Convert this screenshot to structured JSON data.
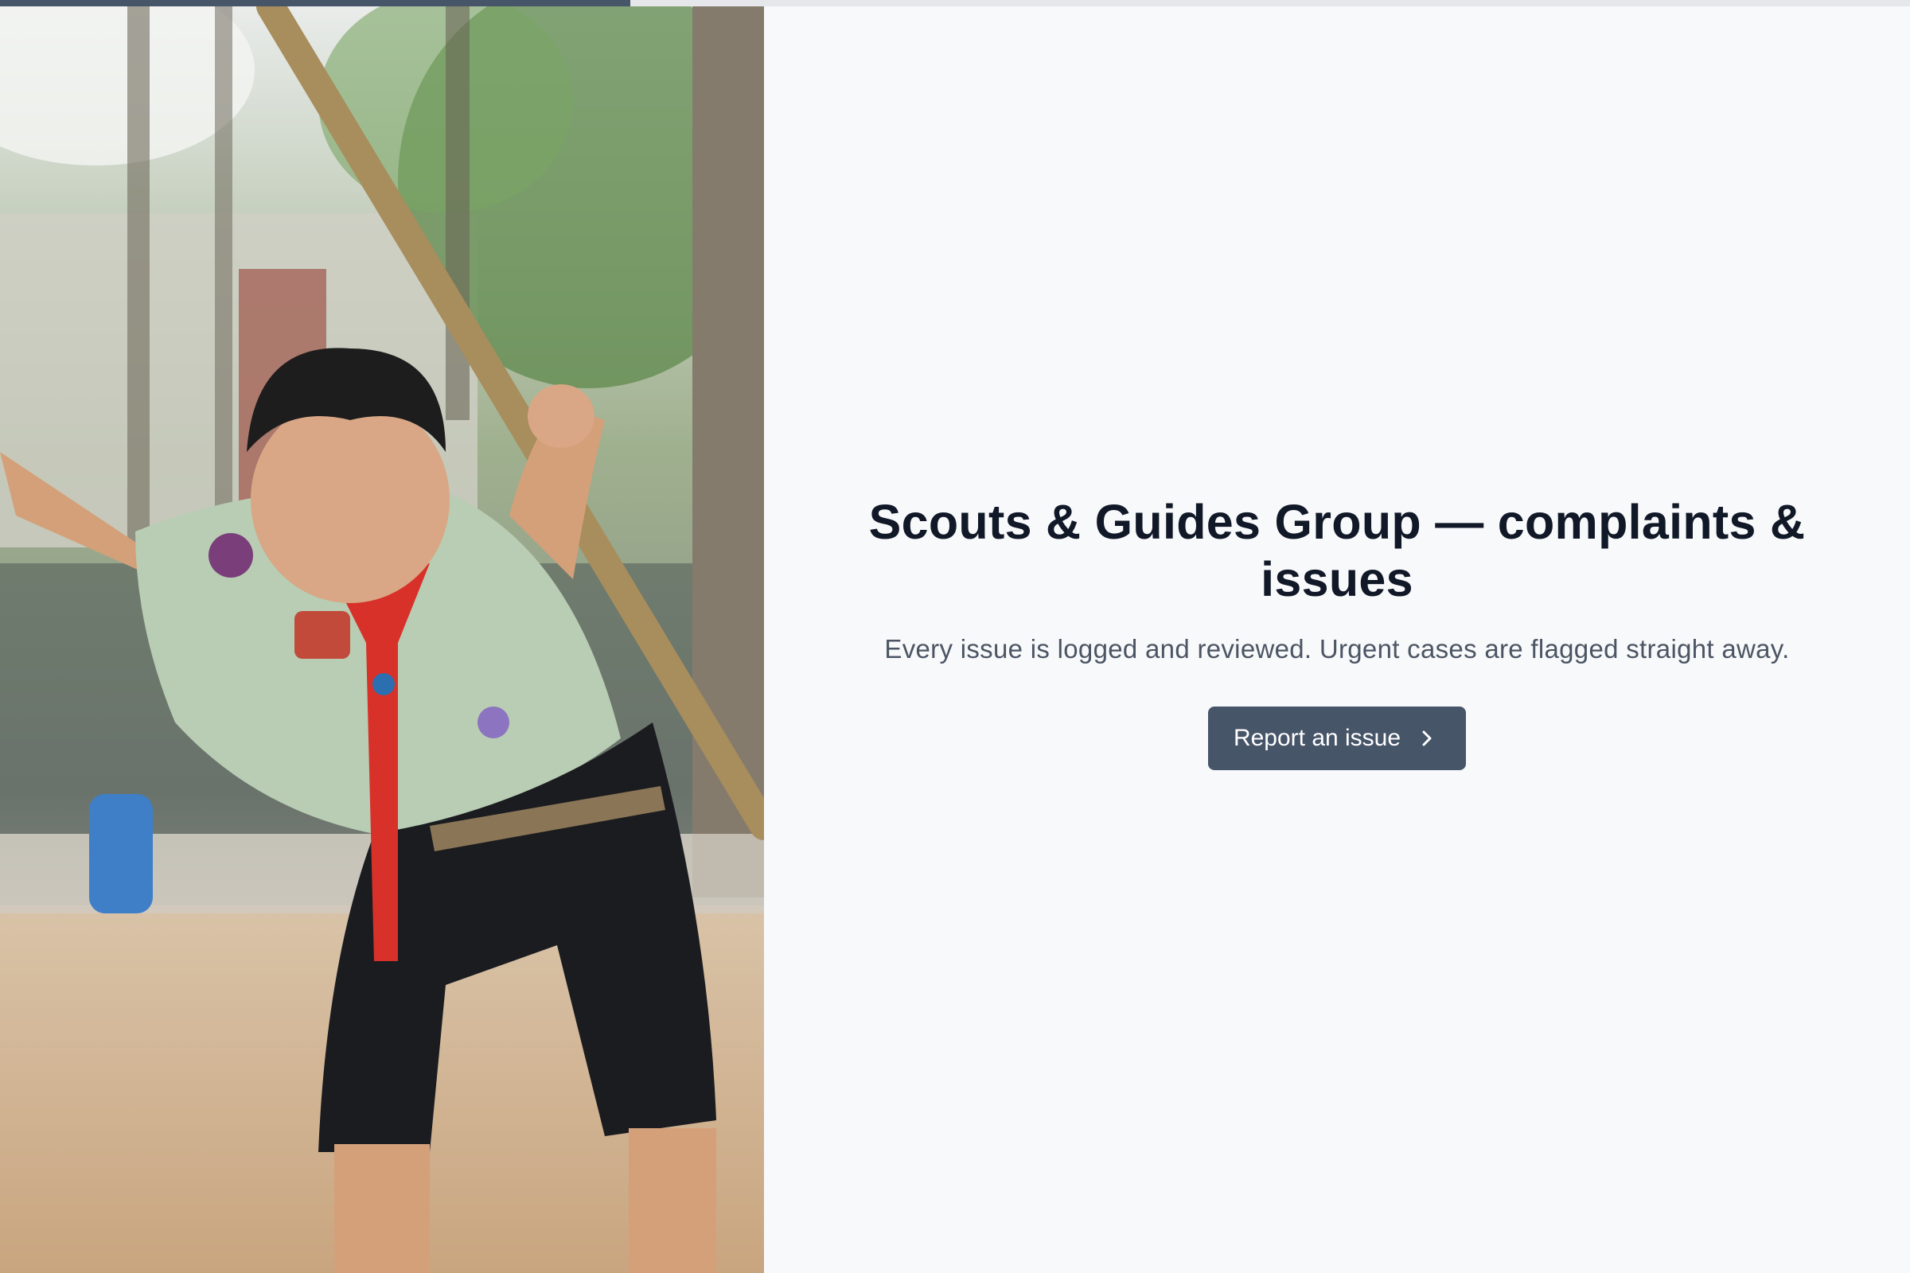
{
  "progress": {
    "value": 0.33,
    "fill_color": "#475569",
    "track_color": "#e5e7eb"
  },
  "hero": {
    "title": "Scouts & Guides Group — complaints & issues",
    "subtitle": "Every issue is logged and reviewed. Urgent cases are flagged straight away.",
    "cta_label": "Report an issue",
    "cta_icon": "chevron-right-icon"
  },
  "colors": {
    "background": "#f8f9fb",
    "title": "#111827",
    "subtitle": "#4b5563",
    "button": "#475569",
    "button_text": "#ffffff"
  }
}
